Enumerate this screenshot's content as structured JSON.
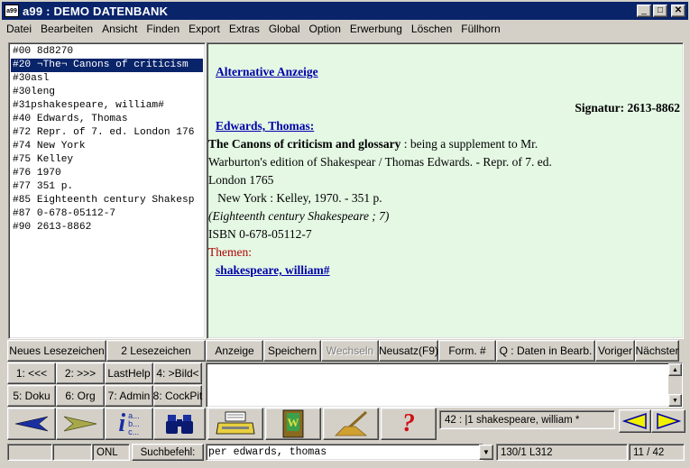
{
  "window": {
    "title": "a99 : DEMO DATENBANK",
    "app_icon_text": "a99",
    "minimize": "_",
    "maximize": "□",
    "close": "✕"
  },
  "menu": [
    "Datei",
    "Bearbeiten",
    "Ansicht",
    "Finden",
    "Export",
    "Extras",
    "Global",
    "Option",
    "Erwerbung",
    "Löschen",
    "Füllhorn"
  ],
  "record_list": [
    "#00 8d8270",
    "#20 ¬The¬ Canons of criticism",
    "#30asl",
    "#30leng",
    "#31pshakespeare, william#",
    "#40 Edwards, Thomas",
    "#72 Repr. of 7. ed. London 176",
    "#74 New York",
    "#75 Kelley",
    "#76 1970",
    "#77 351 p.",
    "#85 Eighteenth century Shakesp",
    "#87 0-678-05112-7",
    "#90 2613-8862"
  ],
  "display": {
    "heading_link": "Alternative Anzeige",
    "signatur": "Signatur: 2613-8862",
    "author_link": "Edwards, Thomas:",
    "title_bold": "The Canons of criticism and glossary",
    "title_rest": " : being a supplement to Mr.",
    "line2": "Warburton's edition of Shakespear / Thomas Edwards. - Repr. of 7. ed.",
    "line3": "London 1765",
    "line4": "   New York : Kelley, 1970. - 351 p.",
    "series": "(Eighteenth century Shakespeare ; 7)",
    "isbn": "ISBN 0-678-05112-7",
    "themen_label": "Themen:",
    "themen_link": "shakespeare, william#"
  },
  "toolbar1": {
    "neues_lesezeichen": "Neues Lesezeichen",
    "lesezeichen": "2 Lesezeichen",
    "anzeige": "Anzeige",
    "speichern": "Speichern",
    "wechseln": "Wechseln",
    "neusatz": "Neusatz(F9)",
    "form": "Form. #",
    "daten": "Q : Daten in Bearb.",
    "voriger": "Voriger",
    "naechster": "Nächster"
  },
  "toolbar2": {
    "b1": "1: <<<",
    "b2": "2: >>>",
    "b3": "LastHelp",
    "b4": "4: >Bild<",
    "b5": "5: Doku",
    "b6": "6: Org",
    "b7": "7: Admin",
    "b8": "8: CockPit"
  },
  "iconbar": {
    "info_letters": [
      "a...",
      "b...",
      "c..."
    ],
    "help_glyph": "?",
    "book_letter": "W",
    "status_text": "42 : |1 shakespeare, william *"
  },
  "statusbar": {
    "mode": "ONL",
    "suchbefehl_label": "Suchbefehl:",
    "search_value": "per edwards, thomas",
    "position": "130/1 L312",
    "count": "11 / 42"
  },
  "colors": {
    "titlebar": "#0a246a",
    "display_bg": "#e4f8e4",
    "link": "#0000aa",
    "themen": "#b00000"
  }
}
